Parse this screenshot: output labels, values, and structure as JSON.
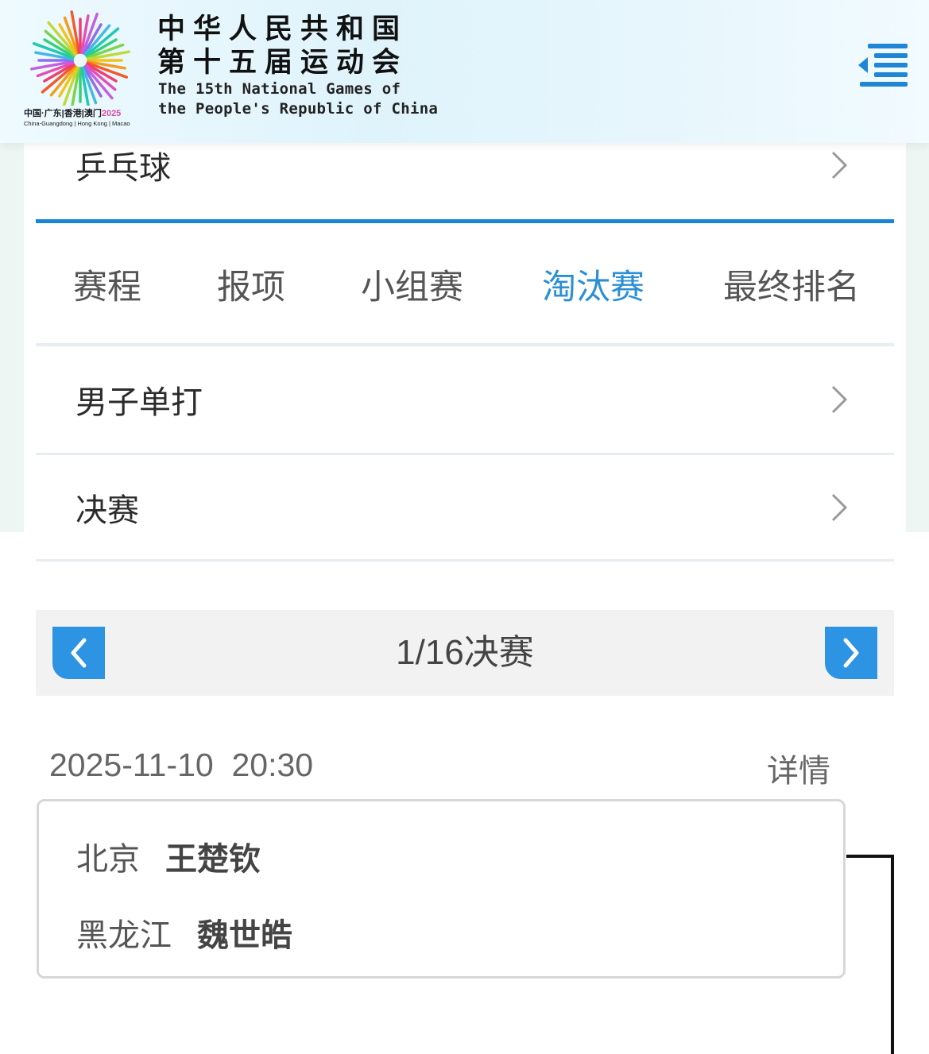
{
  "header": {
    "title_cn_line1": "中华人民共和国",
    "title_cn_line2": "第十五届运动会",
    "title_en_line1": "The 15th National Games of",
    "title_en_line2": "the People's Republic of China",
    "logo_caption_cn": "中国·广东|香港|澳门",
    "logo_caption_year": "2025",
    "logo_caption_en": "China-Guangdong | Hong Kong | Macao",
    "menu_icon": "menu-icon"
  },
  "sport": {
    "label": "乒乓球"
  },
  "tabs": [
    {
      "label": "赛程",
      "active": false
    },
    {
      "label": "报项",
      "active": false
    },
    {
      "label": "小组赛",
      "active": false
    },
    {
      "label": "淘汰赛",
      "active": true
    },
    {
      "label": "最终排名",
      "active": false
    }
  ],
  "event": {
    "label": "男子单打"
  },
  "round": {
    "label": "决赛"
  },
  "round_selector": {
    "title": "1/16决赛"
  },
  "match": {
    "datetime": "2025-11-10  20:30",
    "detail_label": "详情",
    "player1": {
      "team": "北京",
      "name": "王楚钦"
    },
    "player2": {
      "team": "黑龙江",
      "name": "魏世皓"
    }
  },
  "colors": {
    "accent": "#2b8fd6",
    "button_blue": "#2d93e3",
    "divider": "#1a85d6"
  }
}
